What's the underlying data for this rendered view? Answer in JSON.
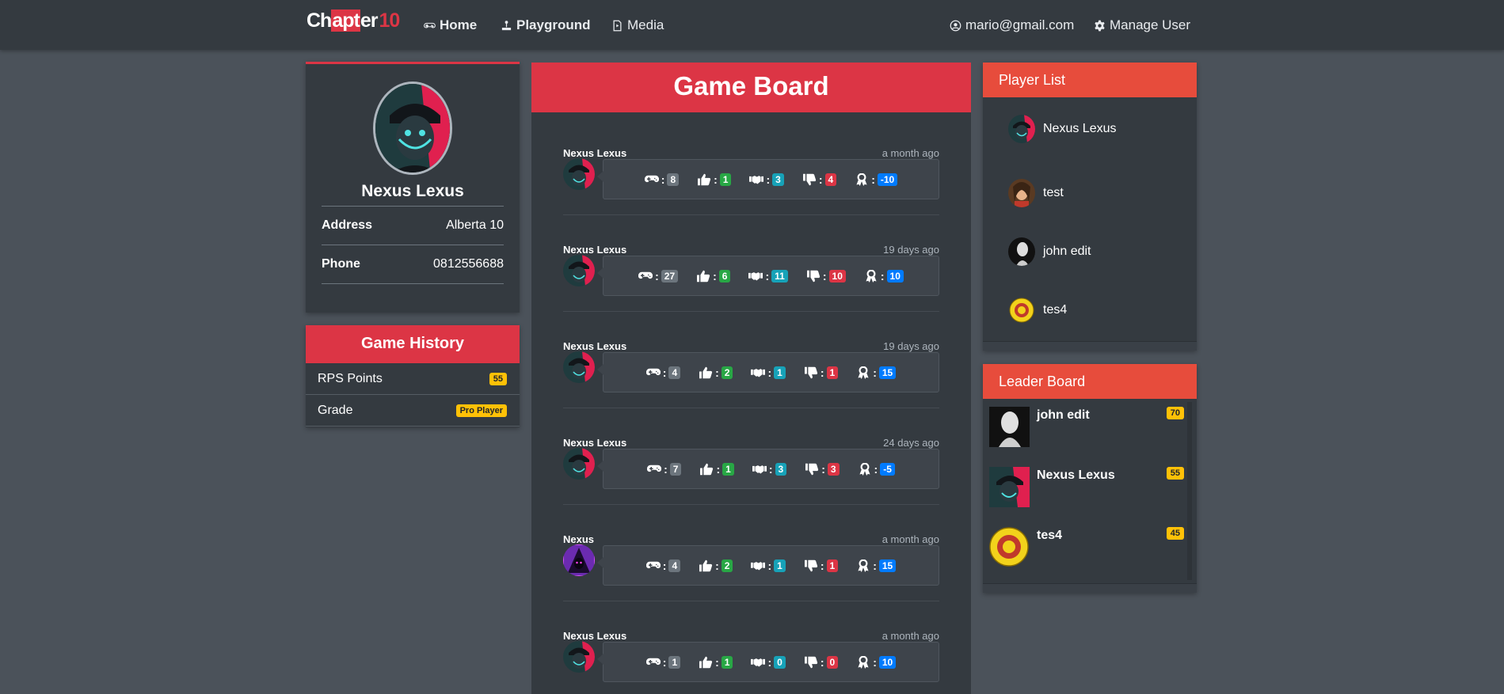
{
  "nav": {
    "brand_prefix": "Ch",
    "brand_highlight": "apt",
    "brand_suffix": "er",
    "brand_number": "10",
    "home": "Home",
    "playground": "Playground",
    "media": "Media",
    "user_email": "mario@gmail.com",
    "manage_user": "Manage User"
  },
  "profile": {
    "name": "Nexus Lexus",
    "address_label": "Address",
    "address_value": "Alberta 10",
    "phone_label": "Phone",
    "phone_value": "0812556688"
  },
  "history": {
    "title": "Game History",
    "rps_label": "RPS Points",
    "rps_value": "55",
    "grade_label": "Grade",
    "grade_value": "Pro Player"
  },
  "board": {
    "title": "Game Board",
    "entries": [
      {
        "user": "Nexus Lexus",
        "time": "a month ago",
        "games": "8",
        "wins": "1",
        "draws": "3",
        "losses": "4",
        "points": "-10",
        "avatar": "mask"
      },
      {
        "user": "Nexus Lexus",
        "time": "19 days ago",
        "games": "27",
        "wins": "6",
        "draws": "11",
        "losses": "10",
        "points": "10",
        "avatar": "mask"
      },
      {
        "user": "Nexus Lexus",
        "time": "19 days ago",
        "games": "4",
        "wins": "2",
        "draws": "1",
        "losses": "1",
        "points": "15",
        "avatar": "mask"
      },
      {
        "user": "Nexus Lexus",
        "time": "24 days ago",
        "games": "7",
        "wins": "1",
        "draws": "3",
        "losses": "3",
        "points": "-5",
        "avatar": "mask"
      },
      {
        "user": "Nexus",
        "time": "a month ago",
        "games": "4",
        "wins": "2",
        "draws": "1",
        "losses": "1",
        "points": "15",
        "avatar": "hood"
      },
      {
        "user": "Nexus Lexus",
        "time": "a month ago",
        "games": "1",
        "wins": "1",
        "draws": "0",
        "losses": "0",
        "points": "10",
        "avatar": "mask"
      }
    ]
  },
  "player_list": {
    "title": "Player List",
    "players": [
      "Nexus Lexus",
      "test",
      "john edit",
      "tes4"
    ]
  },
  "leader_board": {
    "title": "Leader Board",
    "leaders": [
      {
        "name": "john edit",
        "score": "70"
      },
      {
        "name": "Nexus Lexus",
        "score": "55"
      },
      {
        "name": "tes4",
        "score": "45"
      }
    ]
  },
  "colors": {
    "accent_red": "#dc3545",
    "header_orange": "#e74c3c",
    "badge_yellow": "#ffc107",
    "page_bg": "#4b525a",
    "panel_bg": "#343a40"
  },
  "icons": {
    "games": "gamepad-icon",
    "wins": "thumbs-up-icon",
    "draws": "handshake-icon",
    "losses": "thumbs-down-icon",
    "points": "award-icon"
  }
}
